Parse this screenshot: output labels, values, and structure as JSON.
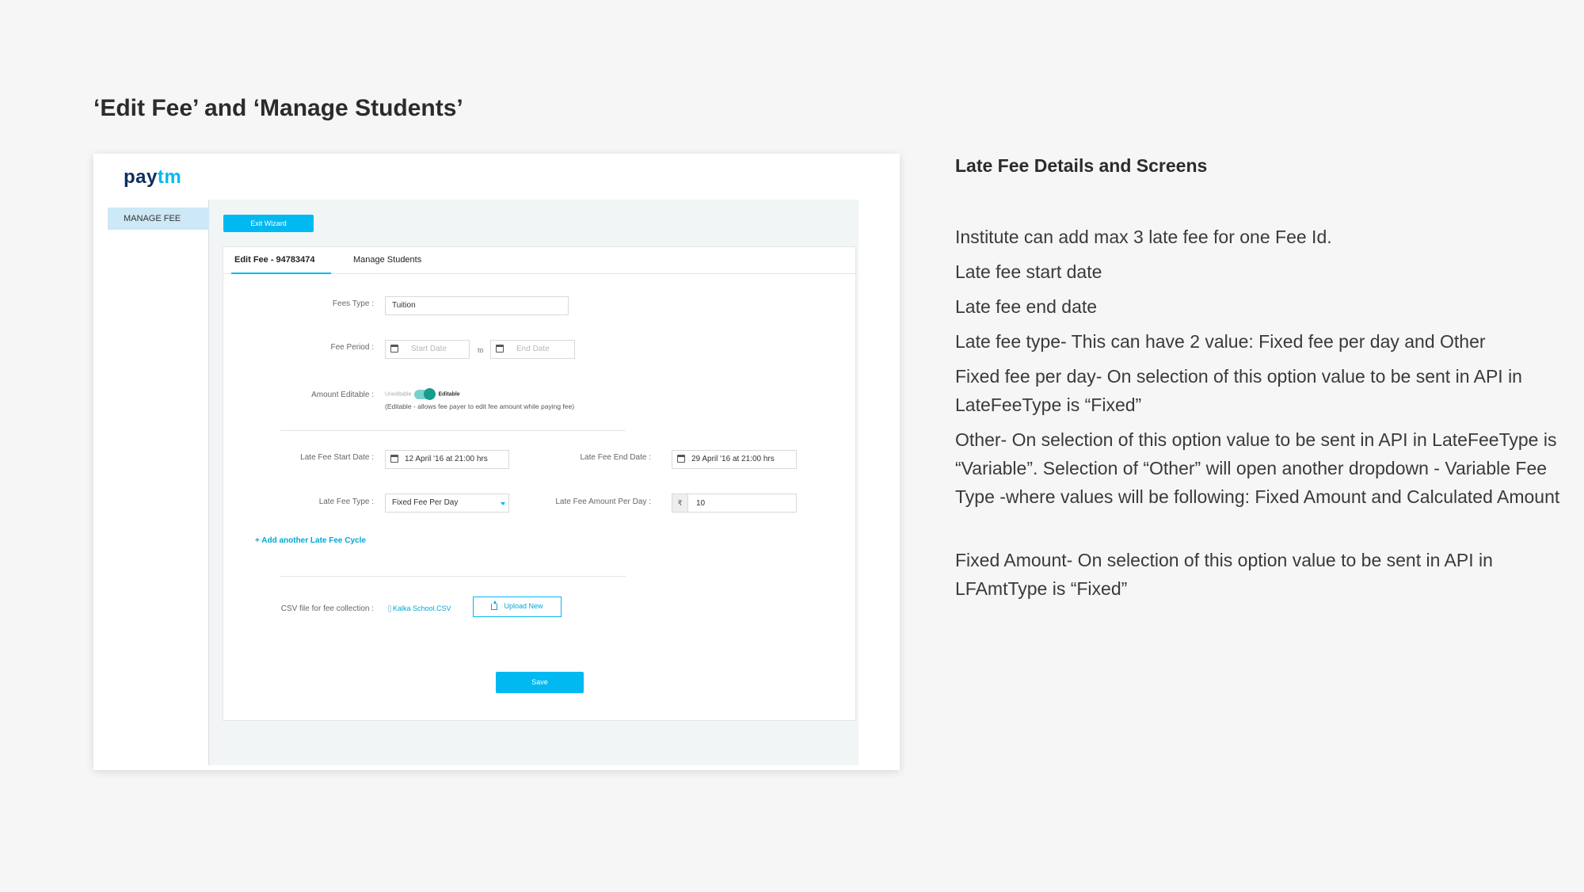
{
  "slide": {
    "title": "‘Edit Fee’ and ‘Manage Students’"
  },
  "app": {
    "logo_part1": "pay",
    "logo_part2": "tm",
    "sidebar": {
      "items": [
        {
          "label": "MANAGE FEE"
        }
      ]
    },
    "exit_button": "Exit Wizard",
    "tabs": [
      {
        "label": "Edit Fee - 94783474"
      },
      {
        "label": "Manage Students"
      }
    ],
    "form": {
      "fees_type_label": "Fees Type :",
      "fees_type_value": "Tuition",
      "fee_period_label": "Fee Period :",
      "start_date_placeholder": "Start Date",
      "to_label": "to",
      "end_date_placeholder": "End Date",
      "amount_editable_label": "Amount Editable :",
      "toggle_off": "Uneditable",
      "toggle_on": "Editable",
      "toggle_note": "(Editable - allows fee payer to edit  fee amount while paying fee)",
      "late_fee_start_label": "Late Fee Start Date :",
      "late_fee_start_value": "12 April '16  at  21:00 hrs",
      "late_fee_end_label": "Late Fee End Date :",
      "late_fee_end_value": "29 April '16  at  21:00 hrs",
      "late_fee_type_label": "Late Fee Type :",
      "late_fee_type_value": "Fixed Fee Per Day",
      "late_fee_amount_label": "Late Fee Amount Per Day :",
      "currency_symbol": "₹",
      "late_fee_amount_value": "10",
      "add_cycle_link": "+ Add another Late Fee Cycle",
      "csv_label": "CSV file for fee collection :",
      "csv_file": "Kalka School.CSV",
      "upload_button": "Upload New",
      "save_button": "Save"
    }
  },
  "notes": {
    "title": "Late Fee Details and Screens",
    "lines": [
      "Institute can add max 3 late fee for one Fee Id.",
      "Late fee start date",
      "Late fee end date",
      "Late fee type- This can have 2 value: Fixed fee per day and Other",
      "Fixed fee per day- On selection of this option value to be sent in API in LateFeeType is “Fixed”",
      "Other- On selection of this option value to be sent in API in LateFeeType is “Variable”. Selection of “Other” will open another dropdown - Variable Fee Type -where values will be following: Fixed Amount and Calculated Amount",
      "Fixed Amount- On selection of this option value to be sent in API in LFAmtType is “Fixed”"
    ]
  },
  "colors": {
    "accent": "#00b9f1",
    "sidebar_active": "#cde8f6",
    "toggle": "#179c8f",
    "logo_dark": "#0b2c5f"
  }
}
